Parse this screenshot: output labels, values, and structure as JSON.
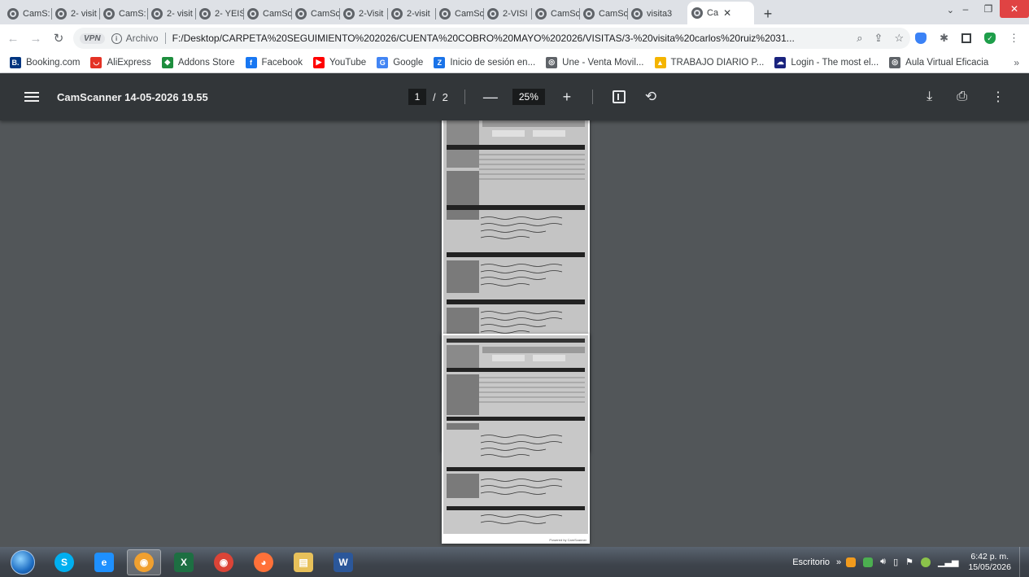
{
  "browser": {
    "tabs": [
      {
        "label": "CamS:",
        "active": false
      },
      {
        "label": "2- visit",
        "active": false
      },
      {
        "label": "CamS:",
        "active": false
      },
      {
        "label": "2- visit",
        "active": false
      },
      {
        "label": "2- YEIS",
        "active": false
      },
      {
        "label": "CamSc",
        "active": false
      },
      {
        "label": "CamSc",
        "active": false
      },
      {
        "label": "2-Visit",
        "active": false
      },
      {
        "label": "2-visit",
        "active": false
      },
      {
        "label": "CamSc",
        "active": false
      },
      {
        "label": "2-VISI",
        "active": false
      },
      {
        "label": "CamSc",
        "active": false
      },
      {
        "label": "CamSc",
        "active": false
      },
      {
        "label": "visita3",
        "active": false
      },
      {
        "label": "Ca",
        "active": true
      }
    ],
    "new_tab_label": "+",
    "tab_search_label": "⌄",
    "window_controls": {
      "minimize": "–",
      "restore": "❐",
      "close": "✕"
    },
    "address": {
      "vpn_label": "VPN",
      "scheme_label": "Archivo",
      "url": "F:/Desktop/CARPETA%20SEGUIMIENTO%202026/CUENTA%20COBRO%20MAYO%202026/VISITAS/3-%20visita%20carlos%20ruiz%2031..."
    },
    "bookmarks": [
      {
        "label": "Booking.com",
        "icon": "booking-icon",
        "color": "#003580",
        "glyph": "B."
      },
      {
        "label": "AliExpress",
        "icon": "aliexpress-icon",
        "color": "#e43225",
        "glyph": "◡"
      },
      {
        "label": "Addons Store",
        "icon": "addons-icon",
        "color": "#1e8e3e",
        "glyph": "◆"
      },
      {
        "label": "Facebook",
        "icon": "facebook-icon",
        "color": "#1877f2",
        "glyph": "f"
      },
      {
        "label": "YouTube",
        "icon": "youtube-icon",
        "color": "#ff0000",
        "glyph": "▶"
      },
      {
        "label": "Google",
        "icon": "google-icon",
        "color": "#4285f4",
        "glyph": "G"
      },
      {
        "label": "Inicio de sesión en...",
        "icon": "zoho-icon",
        "color": "#1a73e8",
        "glyph": "Z"
      },
      {
        "label": "Une - Venta Movil...",
        "icon": "globe-icon",
        "color": "#5f6368",
        "glyph": "◎"
      },
      {
        "label": "TRABAJO DIARIO P...",
        "icon": "drive-icon",
        "color": "#f4b400",
        "glyph": "▲"
      },
      {
        "label": "Login - The most el...",
        "icon": "cloud-icon",
        "color": "#1a237e",
        "glyph": "☁"
      },
      {
        "label": "Aula Virtual Eficacia",
        "icon": "globe-icon",
        "color": "#5f6368",
        "glyph": "◎"
      }
    ],
    "bookmarks_more": "»"
  },
  "pdf_viewer": {
    "title": "CamScanner 14-05-2026 19.55",
    "current_page": "1",
    "page_separator": "/",
    "total_pages": "2",
    "zoom_out": "—",
    "zoom_value": "25%",
    "zoom_in": "+",
    "pages": [
      {
        "footer": "Powered by CamScanner"
      },
      {
        "footer": "Powered by CamScanner"
      }
    ]
  },
  "taskbar": {
    "desktop_label": "Escritorio",
    "expand_label": "»",
    "time": "6:42 p. m.",
    "date": "15/05/2026",
    "apps": [
      {
        "name": "skype-icon",
        "glyph": "S",
        "color": "#00aff0"
      },
      {
        "name": "internet-explorer-icon",
        "glyph": "e",
        "color": "#1e90ff"
      },
      {
        "name": "chrome-canary-icon",
        "glyph": "◉",
        "color": "#f0a030"
      },
      {
        "name": "excel-icon",
        "glyph": "X",
        "color": "#1d6f42"
      },
      {
        "name": "chrome-icon",
        "glyph": "◉",
        "color": "#db4437"
      },
      {
        "name": "firefox-icon",
        "glyph": "◕",
        "color": "#ff7139"
      },
      {
        "name": "file-explorer-icon",
        "glyph": "▤",
        "color": "#e8c15a"
      },
      {
        "name": "word-icon",
        "glyph": "W",
        "color": "#2b579a"
      }
    ]
  }
}
